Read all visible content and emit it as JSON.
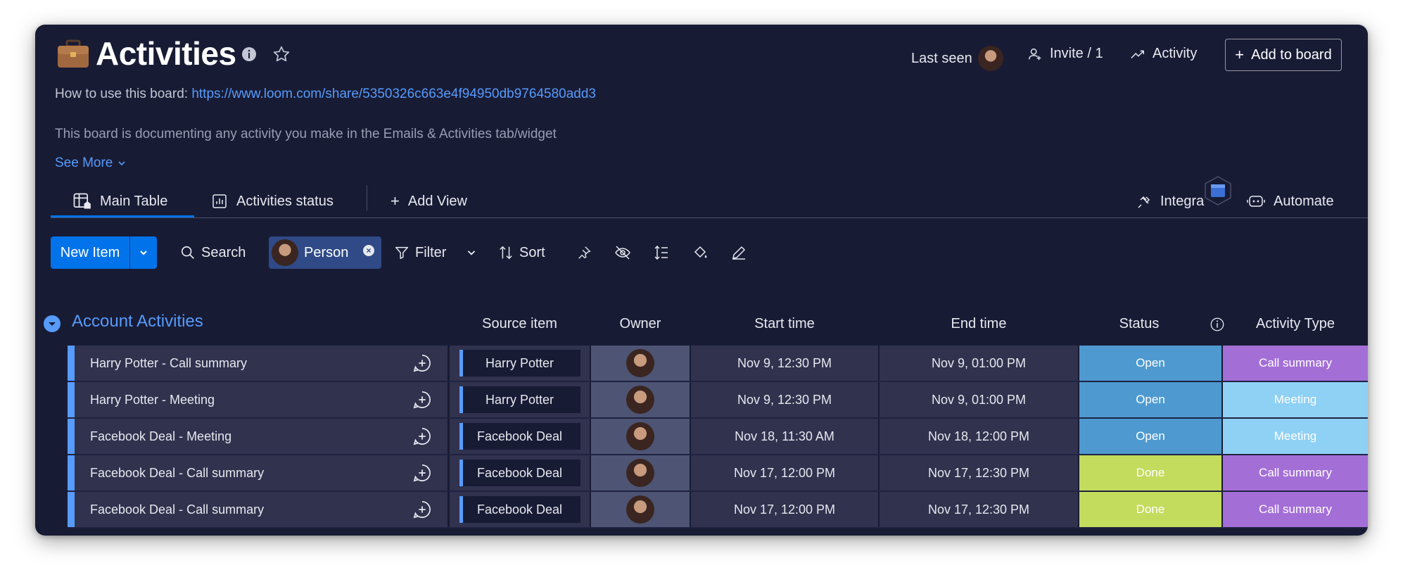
{
  "board": {
    "title": "Activities",
    "howto_label": "How to use this board: ",
    "howto_link": "https://www.loom.com/share/5350326c663e4f94950db9764580add3",
    "description": "This board is documenting any activity you make in the Emails & Activities tab/widget",
    "see_more": "See More"
  },
  "header": {
    "last_seen": "Last seen",
    "invite": "Invite / 1",
    "activity": "Activity",
    "add_to_board": "Add to board"
  },
  "tabs": {
    "main_table": "Main Table",
    "activities_status": "Activities status",
    "add_view": "Add View",
    "integrate": "Integra",
    "automate": "Automate"
  },
  "toolbar": {
    "new_item": "New Item",
    "search": "Search",
    "person": "Person",
    "filter": "Filter",
    "sort": "Sort"
  },
  "group": {
    "title": "Account Activities",
    "columns": {
      "source": "Source item",
      "owner": "Owner",
      "start": "Start time",
      "end": "End time",
      "status": "Status",
      "type": "Activity Type"
    }
  },
  "rows": [
    {
      "name": "Harry Potter - Call summary",
      "source": "Harry Potter",
      "start": "Nov 9, 12:30 PM",
      "end": "Nov 9, 01:00 PM",
      "status": "Open",
      "type": "Call summary"
    },
    {
      "name": "Harry Potter - Meeting",
      "source": "Harry Potter",
      "start": "Nov 9, 12:30 PM",
      "end": "Nov 9, 01:00 PM",
      "status": "Open",
      "type": "Meeting"
    },
    {
      "name": "Facebook Deal - Meeting",
      "source": "Facebook Deal",
      "start": "Nov 18, 11:30 AM",
      "end": "Nov 18, 12:00 PM",
      "status": "Open",
      "type": "Meeting"
    },
    {
      "name": "Facebook Deal - Call summary",
      "source": "Facebook Deal",
      "start": "Nov 17, 12:00 PM",
      "end": "Nov 17, 12:30 PM",
      "status": "Done",
      "type": "Call summary"
    },
    {
      "name": "Facebook Deal - Call summary",
      "source": "Facebook Deal",
      "start": "Nov 17, 12:00 PM",
      "end": "Nov 17, 12:30 PM",
      "status": "Done",
      "type": "Call summary"
    }
  ],
  "colors": {
    "status_open": "#4e9ad0",
    "status_done": "#c4dc5e",
    "type_call_summary": "#a36fd6",
    "type_meeting": "#8fd0f5",
    "accent": "#579bfc",
    "primary_button": "#0073ea"
  }
}
